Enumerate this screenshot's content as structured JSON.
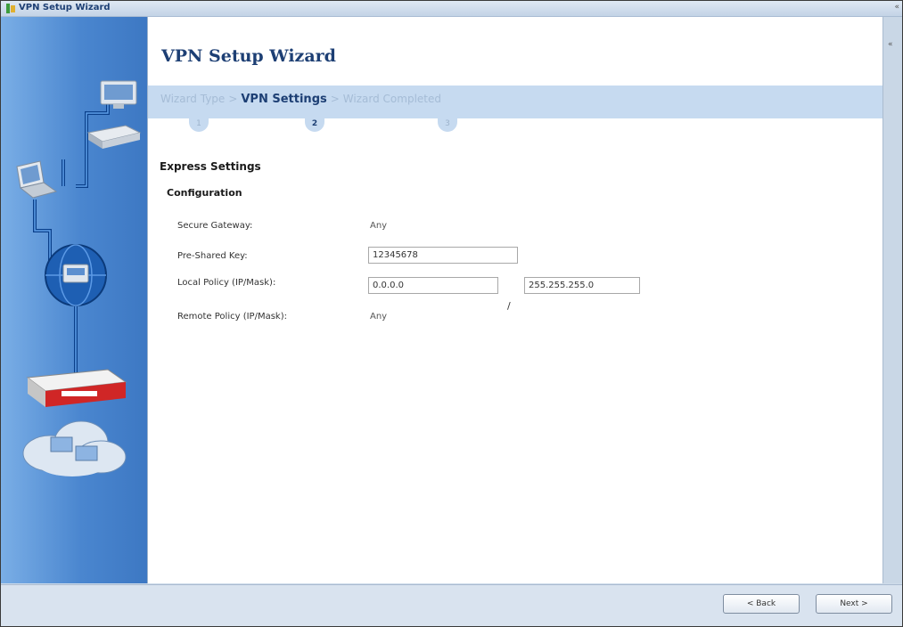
{
  "window": {
    "title": "VPN Setup Wizard"
  },
  "wizard": {
    "heading": "VPN Setup Wizard",
    "steps": [
      {
        "label": "Wizard Type",
        "number": "1"
      },
      {
        "label": "VPN Settings",
        "number": "2"
      },
      {
        "label": "Wizard Completed",
        "number": "3"
      }
    ],
    "separator": ">"
  },
  "form": {
    "section_title": "Express Settings",
    "subsection_title": "Configuration",
    "secure_gateway": {
      "label": "Secure Gateway:",
      "value": "Any"
    },
    "pre_shared_key": {
      "label": "Pre-Shared Key:",
      "value": "12345678"
    },
    "local_policy": {
      "label": "Local Policy (IP/Mask):",
      "ip": "0.0.0.0",
      "separator": "/",
      "mask": "255.255.255.0"
    },
    "remote_policy": {
      "label": "Remote Policy (IP/Mask):",
      "value": "Any"
    }
  },
  "footer": {
    "back_label": "< Back",
    "next_label": "Next >"
  },
  "icons": {
    "app": "wizard-icon",
    "sidebar": [
      "laptop-icon",
      "desktop-computer-icon",
      "switch-icon",
      "globe-icon",
      "router-appliance-icon",
      "cloud-network-icon"
    ]
  },
  "colors": {
    "accent": "#1d3f74",
    "step_bar": "#c6daf0",
    "sidebar": "#4a86cf"
  }
}
